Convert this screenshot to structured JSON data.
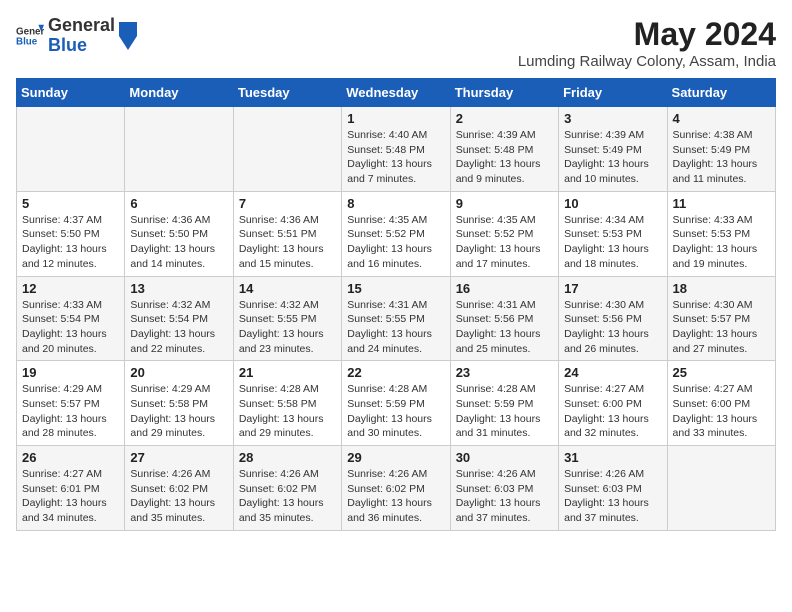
{
  "logo": {
    "general": "General",
    "blue": "Blue"
  },
  "title": "May 2024",
  "subtitle": "Lumding Railway Colony, Assam, India",
  "days_header": [
    "Sunday",
    "Monday",
    "Tuesday",
    "Wednesday",
    "Thursday",
    "Friday",
    "Saturday"
  ],
  "weeks": [
    [
      {
        "num": "",
        "info": ""
      },
      {
        "num": "",
        "info": ""
      },
      {
        "num": "",
        "info": ""
      },
      {
        "num": "1",
        "info": "Sunrise: 4:40 AM\nSunset: 5:48 PM\nDaylight: 13 hours\nand 7 minutes."
      },
      {
        "num": "2",
        "info": "Sunrise: 4:39 AM\nSunset: 5:48 PM\nDaylight: 13 hours\nand 9 minutes."
      },
      {
        "num": "3",
        "info": "Sunrise: 4:39 AM\nSunset: 5:49 PM\nDaylight: 13 hours\nand 10 minutes."
      },
      {
        "num": "4",
        "info": "Sunrise: 4:38 AM\nSunset: 5:49 PM\nDaylight: 13 hours\nand 11 minutes."
      }
    ],
    [
      {
        "num": "5",
        "info": "Sunrise: 4:37 AM\nSunset: 5:50 PM\nDaylight: 13 hours\nand 12 minutes."
      },
      {
        "num": "6",
        "info": "Sunrise: 4:36 AM\nSunset: 5:50 PM\nDaylight: 13 hours\nand 14 minutes."
      },
      {
        "num": "7",
        "info": "Sunrise: 4:36 AM\nSunset: 5:51 PM\nDaylight: 13 hours\nand 15 minutes."
      },
      {
        "num": "8",
        "info": "Sunrise: 4:35 AM\nSunset: 5:52 PM\nDaylight: 13 hours\nand 16 minutes."
      },
      {
        "num": "9",
        "info": "Sunrise: 4:35 AM\nSunset: 5:52 PM\nDaylight: 13 hours\nand 17 minutes."
      },
      {
        "num": "10",
        "info": "Sunrise: 4:34 AM\nSunset: 5:53 PM\nDaylight: 13 hours\nand 18 minutes."
      },
      {
        "num": "11",
        "info": "Sunrise: 4:33 AM\nSunset: 5:53 PM\nDaylight: 13 hours\nand 19 minutes."
      }
    ],
    [
      {
        "num": "12",
        "info": "Sunrise: 4:33 AM\nSunset: 5:54 PM\nDaylight: 13 hours\nand 20 minutes."
      },
      {
        "num": "13",
        "info": "Sunrise: 4:32 AM\nSunset: 5:54 PM\nDaylight: 13 hours\nand 22 minutes."
      },
      {
        "num": "14",
        "info": "Sunrise: 4:32 AM\nSunset: 5:55 PM\nDaylight: 13 hours\nand 23 minutes."
      },
      {
        "num": "15",
        "info": "Sunrise: 4:31 AM\nSunset: 5:55 PM\nDaylight: 13 hours\nand 24 minutes."
      },
      {
        "num": "16",
        "info": "Sunrise: 4:31 AM\nSunset: 5:56 PM\nDaylight: 13 hours\nand 25 minutes."
      },
      {
        "num": "17",
        "info": "Sunrise: 4:30 AM\nSunset: 5:56 PM\nDaylight: 13 hours\nand 26 minutes."
      },
      {
        "num": "18",
        "info": "Sunrise: 4:30 AM\nSunset: 5:57 PM\nDaylight: 13 hours\nand 27 minutes."
      }
    ],
    [
      {
        "num": "19",
        "info": "Sunrise: 4:29 AM\nSunset: 5:57 PM\nDaylight: 13 hours\nand 28 minutes."
      },
      {
        "num": "20",
        "info": "Sunrise: 4:29 AM\nSunset: 5:58 PM\nDaylight: 13 hours\nand 29 minutes."
      },
      {
        "num": "21",
        "info": "Sunrise: 4:28 AM\nSunset: 5:58 PM\nDaylight: 13 hours\nand 29 minutes."
      },
      {
        "num": "22",
        "info": "Sunrise: 4:28 AM\nSunset: 5:59 PM\nDaylight: 13 hours\nand 30 minutes."
      },
      {
        "num": "23",
        "info": "Sunrise: 4:28 AM\nSunset: 5:59 PM\nDaylight: 13 hours\nand 31 minutes."
      },
      {
        "num": "24",
        "info": "Sunrise: 4:27 AM\nSunset: 6:00 PM\nDaylight: 13 hours\nand 32 minutes."
      },
      {
        "num": "25",
        "info": "Sunrise: 4:27 AM\nSunset: 6:00 PM\nDaylight: 13 hours\nand 33 minutes."
      }
    ],
    [
      {
        "num": "26",
        "info": "Sunrise: 4:27 AM\nSunset: 6:01 PM\nDaylight: 13 hours\nand 34 minutes."
      },
      {
        "num": "27",
        "info": "Sunrise: 4:26 AM\nSunset: 6:02 PM\nDaylight: 13 hours\nand 35 minutes."
      },
      {
        "num": "28",
        "info": "Sunrise: 4:26 AM\nSunset: 6:02 PM\nDaylight: 13 hours\nand 35 minutes."
      },
      {
        "num": "29",
        "info": "Sunrise: 4:26 AM\nSunset: 6:02 PM\nDaylight: 13 hours\nand 36 minutes."
      },
      {
        "num": "30",
        "info": "Sunrise: 4:26 AM\nSunset: 6:03 PM\nDaylight: 13 hours\nand 37 minutes."
      },
      {
        "num": "31",
        "info": "Sunrise: 4:26 AM\nSunset: 6:03 PM\nDaylight: 13 hours\nand 37 minutes."
      },
      {
        "num": "",
        "info": ""
      }
    ]
  ]
}
